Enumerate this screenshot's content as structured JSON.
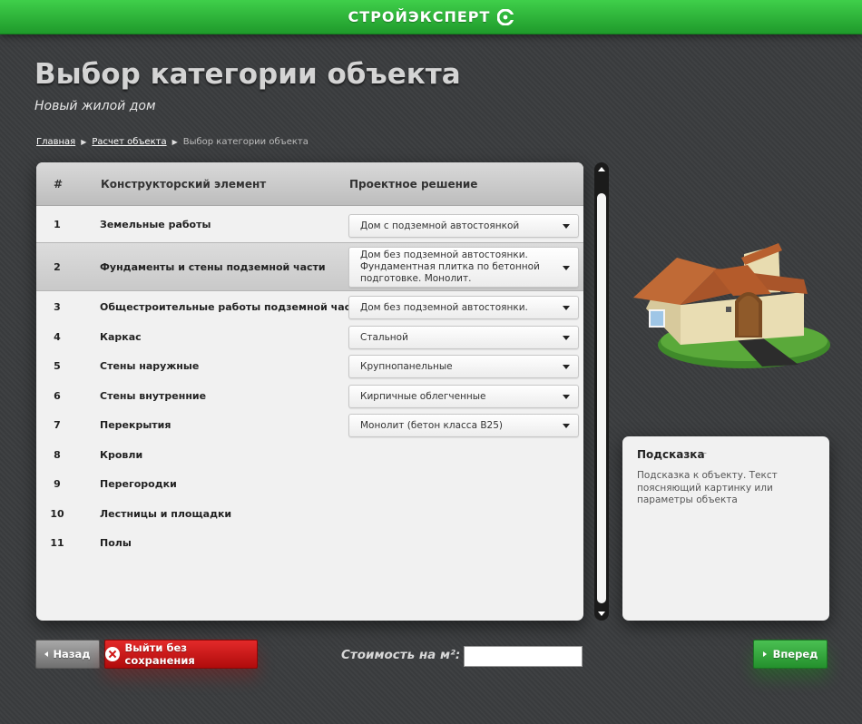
{
  "header": {
    "brand": "СТРОЙЭКСПЕРТ"
  },
  "page": {
    "title": "Выбор категории объекта",
    "subtitle": "Новый жилой дом"
  },
  "breadcrumb": {
    "items": [
      "Главная",
      "Расчет объекта"
    ],
    "current": "Выбор категории объекта"
  },
  "table": {
    "headers": {
      "num": "#",
      "element": "Конструкторский элемент",
      "solution": "Проектное решение"
    },
    "rows": [
      {
        "num": "1",
        "name": "Земельные работы",
        "solution": "Дом с подземной автостоянкой"
      },
      {
        "num": "2",
        "name": "Фундаменты и стены подземной части",
        "solution": "Дом без подземной автостоянки. Фундаментная плитка по бетонной подготовке. Монолит."
      },
      {
        "num": "3",
        "name": "Общестроительные работы подземной части",
        "solution": "Дом без подземной автостоянки."
      },
      {
        "num": "4",
        "name": "Каркас",
        "solution": "Стальной"
      },
      {
        "num": "5",
        "name": "Стены наружные",
        "solution": "Крупнопанельные"
      },
      {
        "num": "6",
        "name": "Стены внутренние",
        "solution": "Кирпичные облегченные"
      },
      {
        "num": "7",
        "name": "Перекрытия",
        "solution": "Монолит (бетон класса B25)"
      },
      {
        "num": "8",
        "name": "Кровли",
        "solution": ""
      },
      {
        "num": "9",
        "name": "Перегородки",
        "solution": ""
      },
      {
        "num": "10",
        "name": "Лестницы и площадки",
        "solution": ""
      },
      {
        "num": "11",
        "name": "Полы",
        "solution": ""
      }
    ]
  },
  "hint": {
    "title": "Подсказка",
    "toggle": "–",
    "text": "Подсказка к объекту. Текст поясняющий картинку или параметры объекта"
  },
  "footer": {
    "back": "Назад",
    "exit": "Выйти без сохранения",
    "cost_label": "Стоимость на м²:",
    "cost_value": "",
    "next": "Вперед"
  }
}
